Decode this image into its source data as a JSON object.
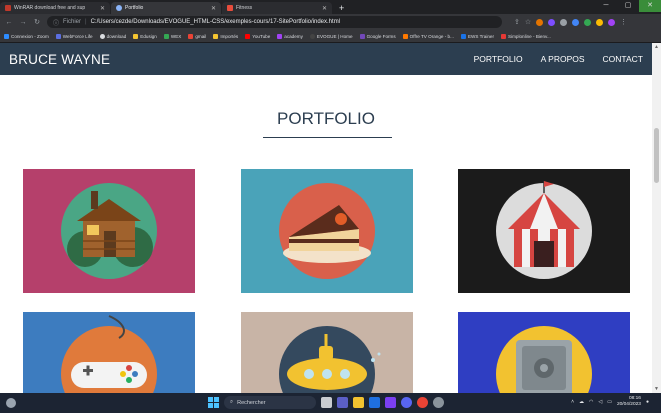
{
  "browser": {
    "tabs": [
      {
        "title": "WinRAR download free and sup",
        "favicon_color": "#c0392b",
        "active": false
      },
      {
        "title": "Portfolio",
        "favicon_color": "#8ab4f8",
        "active": true
      },
      {
        "title": "Fitness",
        "favicon_color": "#e74c3c",
        "active": false
      }
    ],
    "address": {
      "label": "Fichier",
      "url": "C:/Users/cezde/Downloads/EVOGUE_HTML-CSS/exemples-cours/17-SitePortfolio/index.html"
    },
    "bookmarks": [
      {
        "label": "Connexion - Zoom",
        "color": "#2d8cff"
      },
      {
        "label": "WebForce Life",
        "color": "#5b6ee1"
      },
      {
        "label": "download",
        "color": "#dadce0"
      },
      {
        "label": "Edusign",
        "color": "#f4c430"
      },
      {
        "label": "WEX",
        "color": "#34a853"
      },
      {
        "label": "gmail",
        "color": "#ea4335"
      },
      {
        "label": "Importés",
        "color": "#f4c430"
      },
      {
        "label": "YouTube",
        "color": "#ff0000"
      },
      {
        "label": "academy",
        "color": "#a142f4"
      },
      {
        "label": "EVOGUE | Home",
        "color": "#444444"
      },
      {
        "label": "Google Forms",
        "color": "#7248b9"
      },
      {
        "label": "Offre TV Orange - b...",
        "color": "#ff7900"
      },
      {
        "label": "EWS Trainer",
        "color": "#1a73e8"
      },
      {
        "label": "Simplonline - Bienv...",
        "color": "#e53935"
      }
    ]
  },
  "site": {
    "brand": "BRUCE WAYNE",
    "nav": [
      "PORTFOLIO",
      "A PROPOS",
      "CONTACT"
    ],
    "section_title": "PORTFOLIO",
    "header_color": "#2c3e50",
    "items": [
      {
        "name": "cabin",
        "bg": "#b5406b"
      },
      {
        "name": "cake",
        "bg": "#4aa3b9"
      },
      {
        "name": "circus",
        "bg": "#1b1b1b"
      },
      {
        "name": "game",
        "bg": "#3d7cbf"
      },
      {
        "name": "submarine",
        "bg": "#c8b4a6"
      },
      {
        "name": "safe",
        "bg": "#2f3ec2"
      }
    ]
  },
  "taskbar": {
    "search_placeholder": "Rechercher",
    "time": "08:16",
    "date": "20/04/2023"
  }
}
